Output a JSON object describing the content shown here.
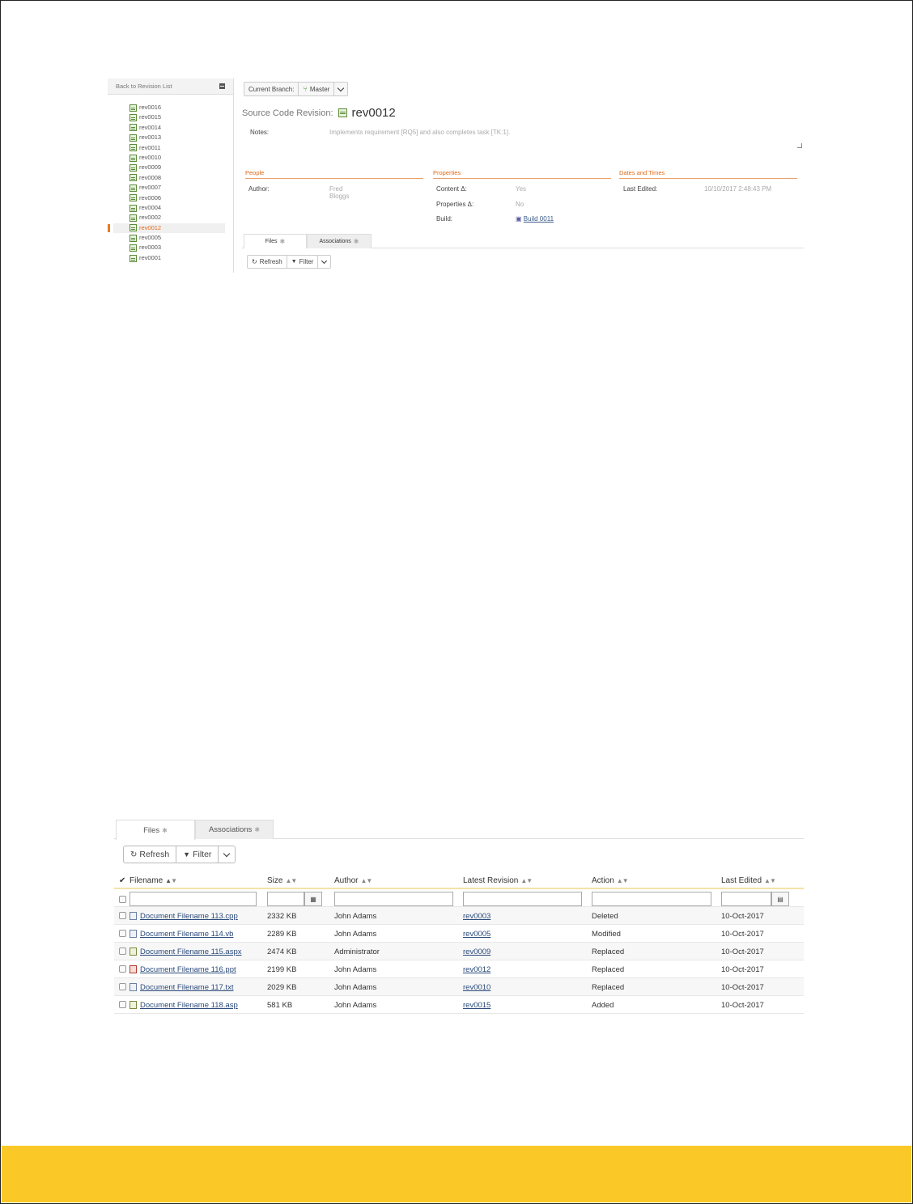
{
  "sidebar": {
    "back_label": "Back to Revision List",
    "revisions": [
      "rev0016",
      "rev0015",
      "rev0014",
      "rev0013",
      "rev0011",
      "rev0010",
      "rev0009",
      "rev0008",
      "rev0007",
      "rev0006",
      "rev0004",
      "rev0002",
      "rev0012",
      "rev0005",
      "rev0003",
      "rev0001"
    ],
    "selected": "rev0012"
  },
  "branch": {
    "label": "Current Branch:",
    "value": "Master"
  },
  "revision": {
    "title_label": "Source Code Revision:",
    "name": "rev0012",
    "notes_label": "Notes:",
    "notes_value": "Implements requirement [RQ5] and also completes task [TK:1]."
  },
  "sections": {
    "people": {
      "title": "People",
      "author_label": "Author:",
      "author_value": "Fred Bloggs"
    },
    "properties": {
      "title": "Properties",
      "content_label": "Content Δ:",
      "content_value": "Yes",
      "props_label": "Properties Δ:",
      "props_value": "No",
      "build_label": "Build:",
      "build_value": "Build 0011"
    },
    "dates": {
      "title": "Dates and Times",
      "last_edited_label": "Last Edited:",
      "last_edited_value": "10/10/2017 2:48:43 PM"
    }
  },
  "tabs": {
    "files": "Files",
    "associations": "Associations"
  },
  "toolbar": {
    "refresh": "Refresh",
    "filter": "Filter"
  },
  "grid": {
    "headers": {
      "filename": "Filename",
      "size": "Size",
      "author": "Author",
      "latest_revision": "Latest Revision",
      "action": "Action",
      "last_edited": "Last Edited"
    },
    "rows": [
      {
        "filename": "Document Filename 113.cpp",
        "icon": "cpp-file-icon",
        "size": "2332 KB",
        "author": "John Adams",
        "revision": "rev0003",
        "action": "Deleted",
        "edited": "10-Oct-2017"
      },
      {
        "filename": "Document Filename 114.vb",
        "icon": "vb-file-icon",
        "size": "2289 KB",
        "author": "John Adams",
        "revision": "rev0005",
        "action": "Modified",
        "edited": "10-Oct-2017"
      },
      {
        "filename": "Document Filename 115.aspx",
        "icon": "aspx-file-icon",
        "size": "2474 KB",
        "author": "Administrator",
        "revision": "rev0009",
        "action": "Replaced",
        "edited": "10-Oct-2017"
      },
      {
        "filename": "Document Filename 116.ppt",
        "icon": "ppt-file-icon",
        "size": "2199 KB",
        "author": "John Adams",
        "revision": "rev0012",
        "action": "Replaced",
        "edited": "10-Oct-2017"
      },
      {
        "filename": "Document Filename 117.txt",
        "icon": "txt-file-icon",
        "size": "2029 KB",
        "author": "John Adams",
        "revision": "rev0010",
        "action": "Replaced",
        "edited": "10-Oct-2017"
      },
      {
        "filename": "Document Filename 118.asp",
        "icon": "asp-file-icon",
        "size": "581 KB",
        "author": "John Adams",
        "revision": "rev0015",
        "action": "Added",
        "edited": "10-Oct-2017"
      }
    ]
  },
  "colors": {
    "accent_orange": "#e06a1a",
    "footer_yellow": "#fbc927",
    "link_blue": "#2a4a7a"
  }
}
